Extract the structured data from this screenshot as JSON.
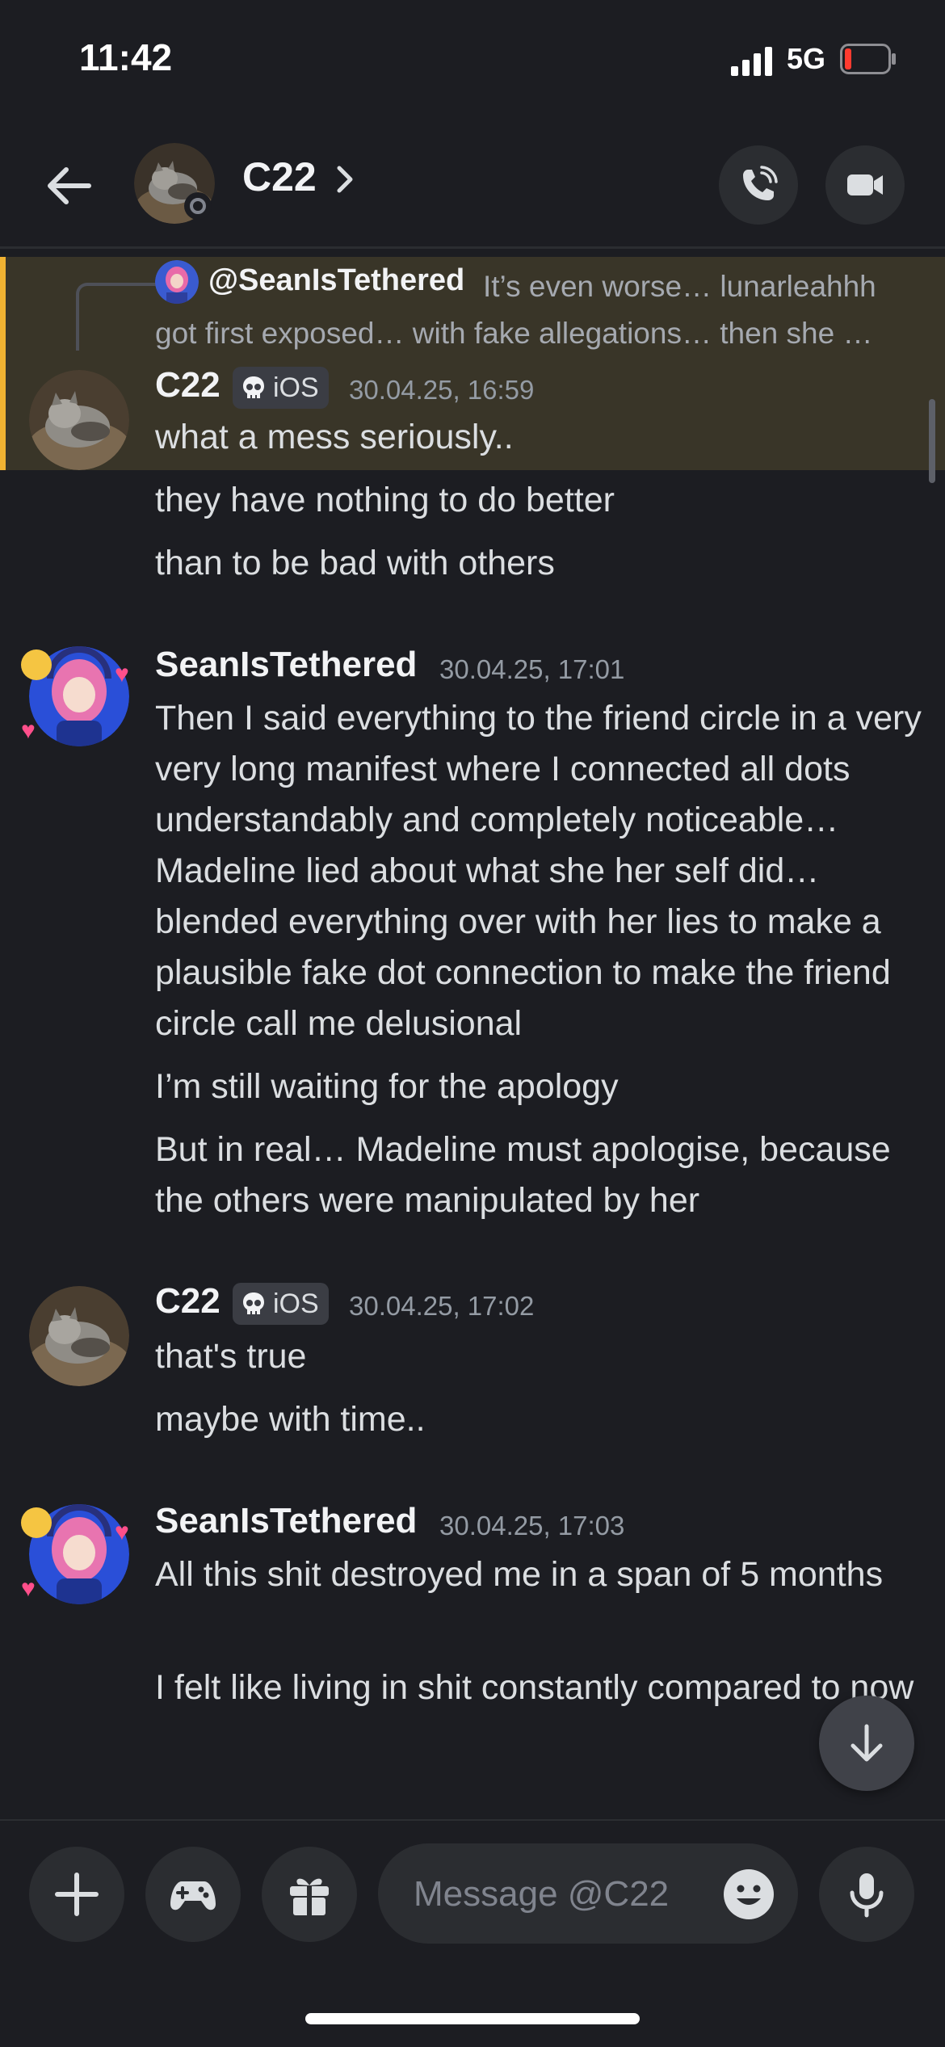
{
  "status_bar": {
    "time": "11:42",
    "network": "5G"
  },
  "header": {
    "contact_name": "C22"
  },
  "reply_preview": {
    "mention": "@SeanIsTethered",
    "text": "It’s even worse… lunarleahhh got first exposed… with fake allegations… then she …"
  },
  "messages": [
    {
      "author": "C22",
      "tag": "iOS",
      "timestamp": "30.04.25, 16:59",
      "lines": [
        "what a mess seriously..",
        "they have nothing to do better",
        "than to be bad with others"
      ]
    },
    {
      "author": "SeanIsTethered",
      "timestamp": "30.04.25, 17:01",
      "lines": [
        "Then I said everything to the friend circle in a very very long manifest where I connected all dots understandably and completely noticeable… Madeline lied about what she her self did… blended everything over with her lies to make a plausible fake dot connection to make the friend circle call me delusional",
        "I’m still waiting for the apology",
        "But in real… Madeline must apologise, because the others were manipulated by her"
      ]
    },
    {
      "author": "C22",
      "tag": "iOS",
      "timestamp": "30.04.25, 17:02",
      "lines": [
        "that's true",
        "maybe with time.."
      ]
    },
    {
      "author": "SeanIsTethered",
      "timestamp": "30.04.25, 17:03",
      "lines": [
        "All this shit destroyed me in a span of 5 months",
        "I felt like living in shit constantly compared to now"
      ]
    }
  ],
  "composer": {
    "placeholder": "Message @C22"
  },
  "icons": [
    "back-arrow-icon",
    "chevron-right-icon",
    "phone-icon",
    "video-camera-icon",
    "skull-icon",
    "arrow-down-icon",
    "plus-icon",
    "gamepad-icon",
    "gift-icon",
    "emoji-icon",
    "microphone-icon"
  ],
  "colors": {
    "background": "#1c1d22",
    "highlight": "#393528",
    "highlight_bar": "#f0b232",
    "muted": "#949ba4"
  }
}
